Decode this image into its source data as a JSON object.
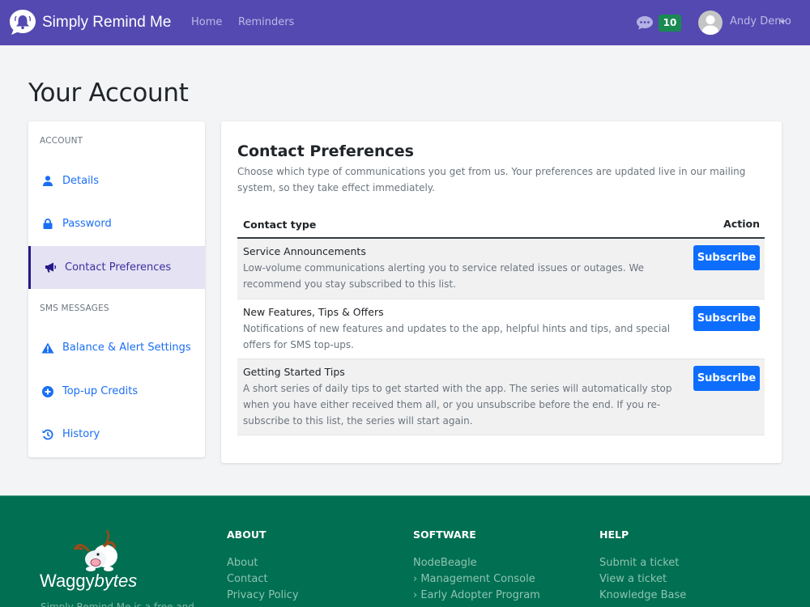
{
  "navbar": {
    "brand": "Simply Remind Me",
    "links": [
      "Home",
      "Reminders"
    ],
    "message_count": "10",
    "user_name": "Andy Demo",
    "colors": {
      "background": "#5449b0",
      "badge": "#198a52"
    }
  },
  "page": {
    "title": "Your Account"
  },
  "sidebar": {
    "sections": [
      {
        "heading": "ACCOUNT",
        "items": [
          {
            "label": "Details",
            "icon": "user-icon",
            "active": false
          },
          {
            "label": "Password",
            "icon": "lock-icon",
            "active": false
          },
          {
            "label": "Contact Preferences",
            "icon": "megaphone-icon",
            "active": true
          }
        ]
      },
      {
        "heading": "SMS MESSAGES",
        "items": [
          {
            "label": "Balance & Alert Settings",
            "icon": "warning-icon",
            "active": false
          },
          {
            "label": "Top-up Credits",
            "icon": "plus-circle-icon",
            "active": false
          },
          {
            "label": "History",
            "icon": "history-icon",
            "active": false
          }
        ]
      }
    ]
  },
  "main": {
    "title": "Contact Preferences",
    "description": "Choose which type of communications you get from us. Your preferences are updated live in our mailing system, so they take effect immediately.",
    "table": {
      "headers": {
        "type": "Contact type",
        "action": "Action"
      },
      "rows": [
        {
          "title": "Service Announcements",
          "description": "Low-volume communications alerting you to service related issues or outages. We recommend you stay subscribed to this list.",
          "action": "Subscribe"
        },
        {
          "title": "New Features, Tips & Offers",
          "description": "Notifications of new features and updates to the app, helpful hints and tips, and special offers for SMS top-ups.",
          "action": "Subscribe"
        },
        {
          "title": "Getting Started Tips",
          "description": "A short series of daily tips to get started with the app. The series will automatically stop when you have either received them all, or you unsubscribe before the end. If you re-subscribe to this list, the series will start again.",
          "action": "Subscribe"
        }
      ]
    }
  },
  "footer": {
    "brand_plain": "Waggy",
    "brand_italic": "bytes",
    "tagline": "Simply Remind Me is a free and",
    "columns": [
      {
        "heading": "ABOUT",
        "links": [
          "About",
          "Contact",
          "Privacy Policy"
        ]
      },
      {
        "heading": "SOFTWARE",
        "links": [
          "NodeBeagle",
          "›  Management Console",
          "›  Early Adopter Program"
        ]
      },
      {
        "heading": "HELP",
        "links": [
          "Submit a ticket",
          "View a ticket",
          "Knowledge Base"
        ]
      }
    ],
    "colors": {
      "background": "#006f52"
    }
  }
}
